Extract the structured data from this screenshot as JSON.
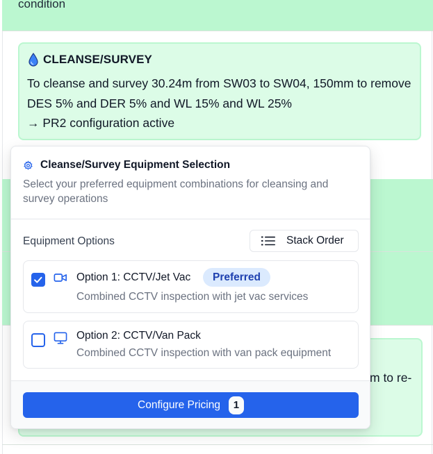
{
  "background": {
    "top_text": "condition",
    "peek_text": "m to re-"
  },
  "cleanse_survey": {
    "icon": "droplet-icon",
    "title": "CLEANSE/SURVEY",
    "description": "To cleanse and survey 30.24m from SW03 to SW04, 150mm to remove DES 5% and DER 5% and WL 15% and WL 25%",
    "status": "→ PR2 configuration active"
  },
  "modal": {
    "title": "Cleanse/Survey Equipment Selection",
    "title_icon": "gear-icon",
    "subtitle": "Select your preferred equipment combinations for cleansing and survey operations",
    "section_label": "Equipment Options",
    "stack_order_label": "Stack Order",
    "options": [
      {
        "title": "Option 1: CCTV/Jet Vac",
        "description": "Combined CCTV inspection with jet vac services",
        "badge": "Preferred",
        "checked": true,
        "icon": "video-camera-icon"
      },
      {
        "title": "Option 2: CCTV/Van Pack",
        "description": "Combined CCTV inspection with van pack equipment",
        "checked": false,
        "icon": "monitor-icon"
      }
    ],
    "configure_button": {
      "label": "Configure Pricing",
      "count": "1"
    }
  },
  "colors": {
    "accent": "#2563eb",
    "green_band": "#bbf7d0",
    "green_card": "#dcfce7",
    "badge_bg": "#dbeafe",
    "badge_text": "#1e40af"
  }
}
